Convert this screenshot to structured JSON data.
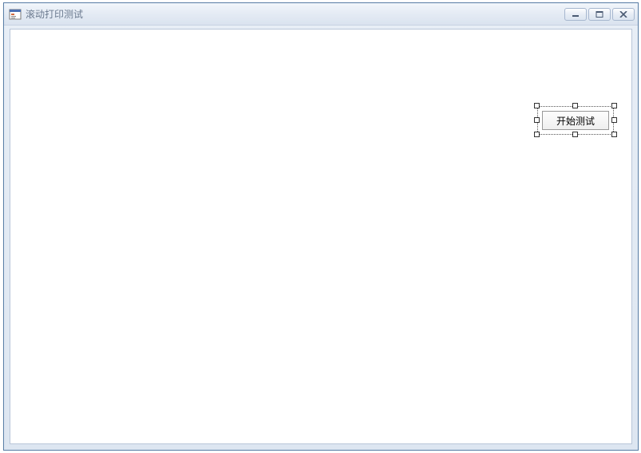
{
  "window": {
    "title": "滚动打印测试"
  },
  "form": {
    "button_label": "开始测试"
  }
}
